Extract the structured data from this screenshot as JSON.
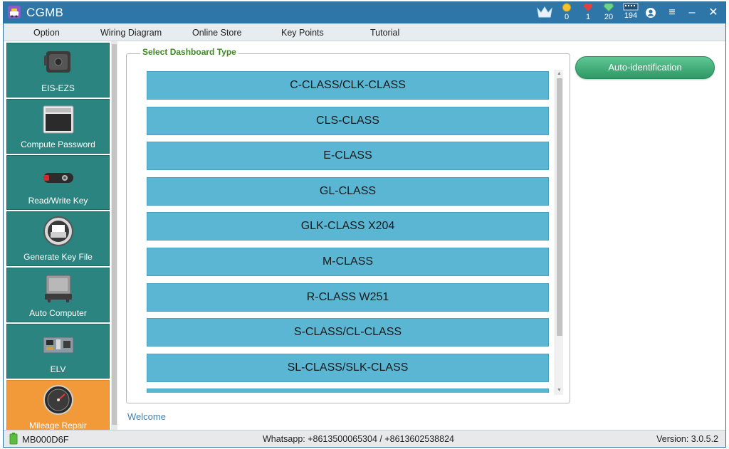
{
  "window": {
    "title": "CGMB",
    "stats": [
      {
        "icon": "crown-icon",
        "value": ""
      },
      {
        "icon": "coin-icon",
        "value": "0"
      },
      {
        "icon": "heart-icon",
        "value": "1"
      },
      {
        "icon": "diamond-icon",
        "value": "20"
      },
      {
        "icon": "token-icon",
        "value": "194"
      }
    ],
    "buttons": {
      "user": "●",
      "menu": "≡",
      "minimize": "–",
      "close": "✕"
    }
  },
  "menu": {
    "items": [
      "Option",
      "Wiring Diagram",
      "Online Store",
      "Key Points",
      "Tutorial"
    ]
  },
  "sidebar": {
    "items": [
      {
        "label": "EIS-EZS",
        "icon": "ezs-module-icon"
      },
      {
        "label": "Compute Password",
        "icon": "monitor-icon"
      },
      {
        "label": "Read/Write Key",
        "icon": "car-key-icon"
      },
      {
        "label": "Generate Key File",
        "icon": "printer-icon"
      },
      {
        "label": "Auto Computer",
        "icon": "ecu-icon"
      },
      {
        "label": "ELV",
        "icon": "circuit-board-icon"
      },
      {
        "label": "Mileage Repair",
        "icon": "speedometer-icon"
      }
    ],
    "active_index": 6
  },
  "main": {
    "group_title": "Select Dashboard Type",
    "dashboard_types": [
      "C-CLASS/CLK-CLASS",
      "CLS-CLASS",
      "E-CLASS",
      "GL-CLASS",
      "GLK-CLASS X204",
      "M-CLASS",
      "R-CLASS W251",
      "S-CLASS/CL-CLASS",
      "SL-CLASS/SLK-CLASS",
      ""
    ],
    "auto_button": "Auto-identification",
    "welcome": "Welcome"
  },
  "status": {
    "device_id": "MB000D6F",
    "contact": "Whatsapp: +8613500065304 / +8613602538824",
    "version": "Version: 3.0.5.2"
  },
  "colors": {
    "titlebar": "#2e76a8",
    "sidebar_item": "#2b8480",
    "sidebar_active": "#f29a3a",
    "list_button": "#5bb6d3",
    "auto_button": "#3aa874",
    "group_title": "#3a8a1e"
  }
}
